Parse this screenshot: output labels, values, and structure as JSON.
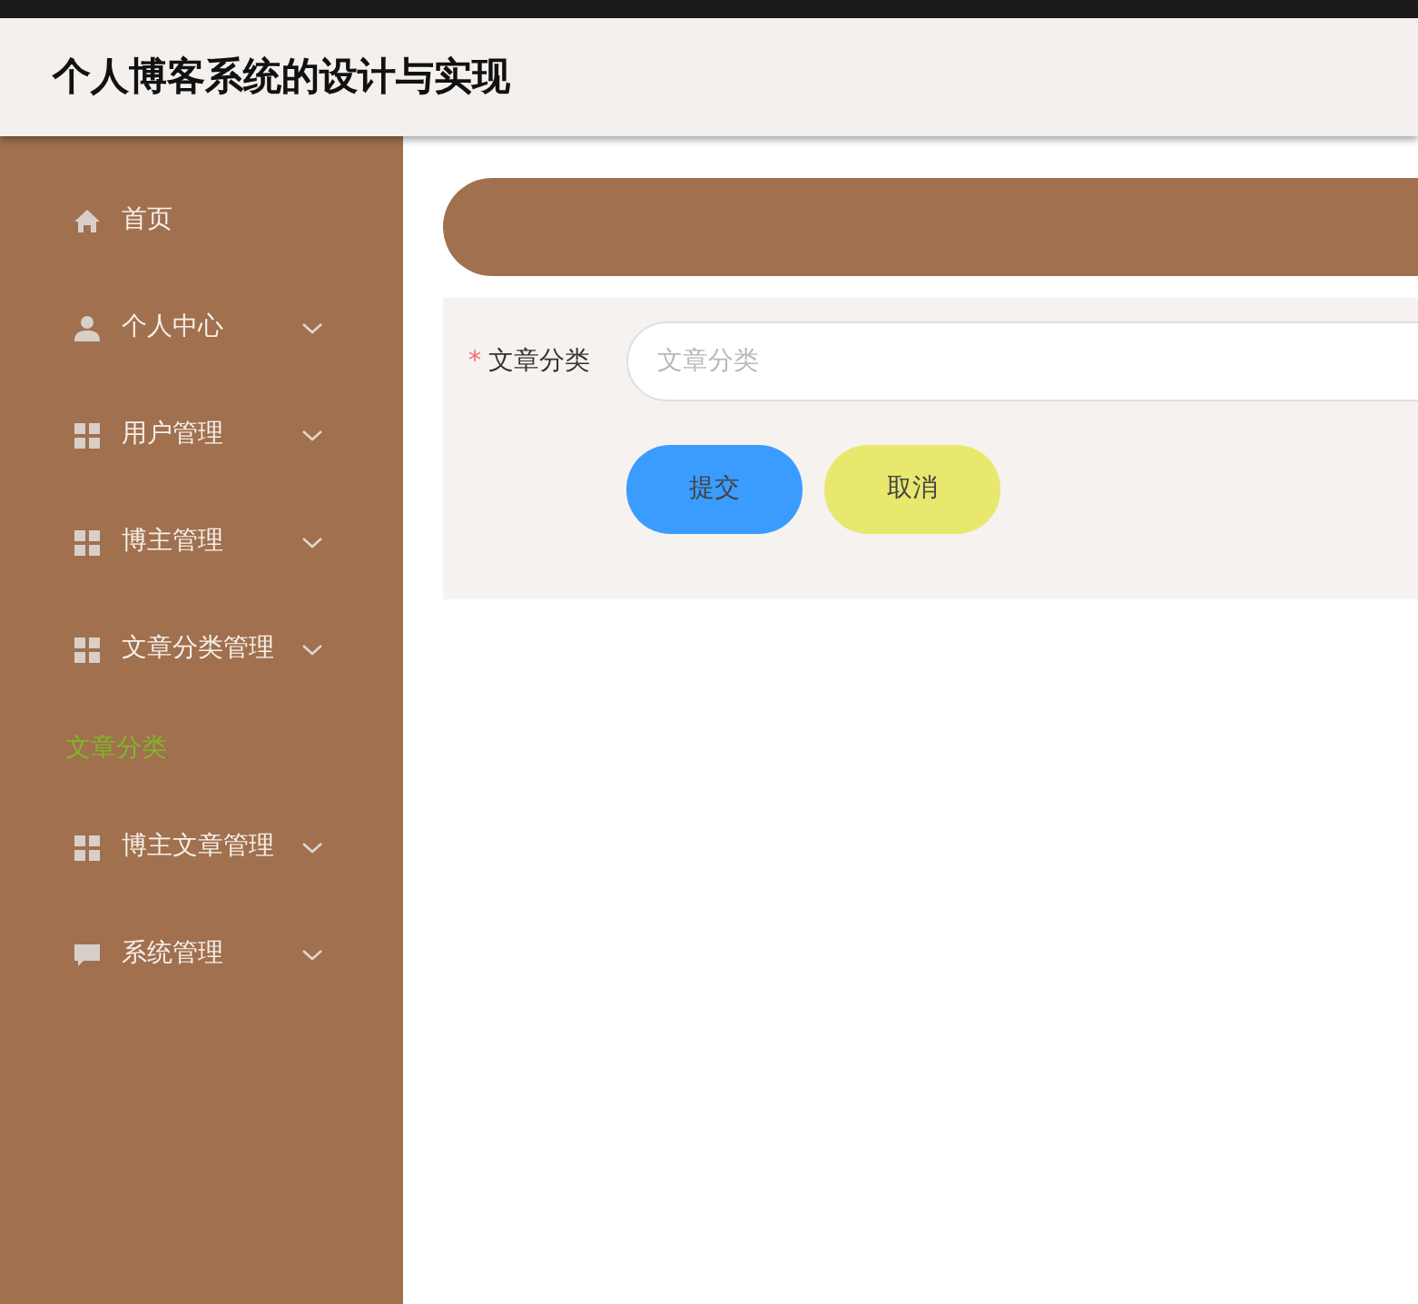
{
  "header": {
    "title": "个人博客系统的设计与实现"
  },
  "sidebar": {
    "items": [
      {
        "kind": "link",
        "label": "首页"
      },
      {
        "kind": "menu",
        "label": "个人中心"
      },
      {
        "kind": "menu",
        "label": "用户管理"
      },
      {
        "kind": "menu",
        "label": "博主管理"
      },
      {
        "kind": "menu",
        "label": "文章分类管理"
      },
      {
        "kind": "subitem",
        "label": "文章分类",
        "selected": true
      },
      {
        "kind": "menu",
        "label": "博主文章管理"
      },
      {
        "kind": "menu",
        "label": "系统管理"
      }
    ]
  },
  "form": {
    "fields": [
      {
        "label": "文章分类",
        "required_mark": "*",
        "placeholder": "文章分类"
      }
    ],
    "buttons": [
      {
        "kind": "primary",
        "label": "提交"
      },
      {
        "kind": "cancel",
        "label": "取消"
      }
    ]
  }
}
